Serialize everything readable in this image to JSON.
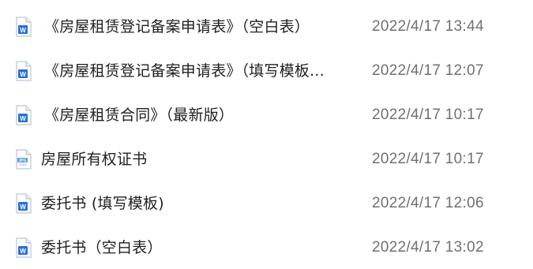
{
  "files": [
    {
      "name": "《房屋租赁登记备案申请表》（空白表）",
      "date": "2022/4/17 13:44",
      "icon": "word-doc-icon",
      "bracketed": true
    },
    {
      "name": "《房屋租赁登记备案申请表》（填写模板...",
      "date": "2022/4/17 12:07",
      "icon": "word-doc-icon",
      "bracketed": true
    },
    {
      "name": "《房屋租赁合同》（最新版）",
      "date": "2022/4/17 10:17",
      "icon": "word-doc-icon",
      "bracketed": true
    },
    {
      "name": "房屋所有权证书",
      "date": "2022/4/17 10:17",
      "icon": "image-file-icon",
      "bracketed": false
    },
    {
      "name": "委托书 (填写模板)",
      "date": "2022/4/17 12:06",
      "icon": "word-doc-icon",
      "bracketed": false
    },
    {
      "name": "委托书（空白表）",
      "date": "2022/4/17 13:02",
      "icon": "word-doc-icon",
      "bracketed": false
    }
  ],
  "colors": {
    "word_icon": "#2b6fd6",
    "image_icon": "#5b9bd5",
    "name_text": "#1f1f1f",
    "date_text": "#707070"
  },
  "icon_labels": {
    "word": "W",
    "image": "JPG"
  }
}
